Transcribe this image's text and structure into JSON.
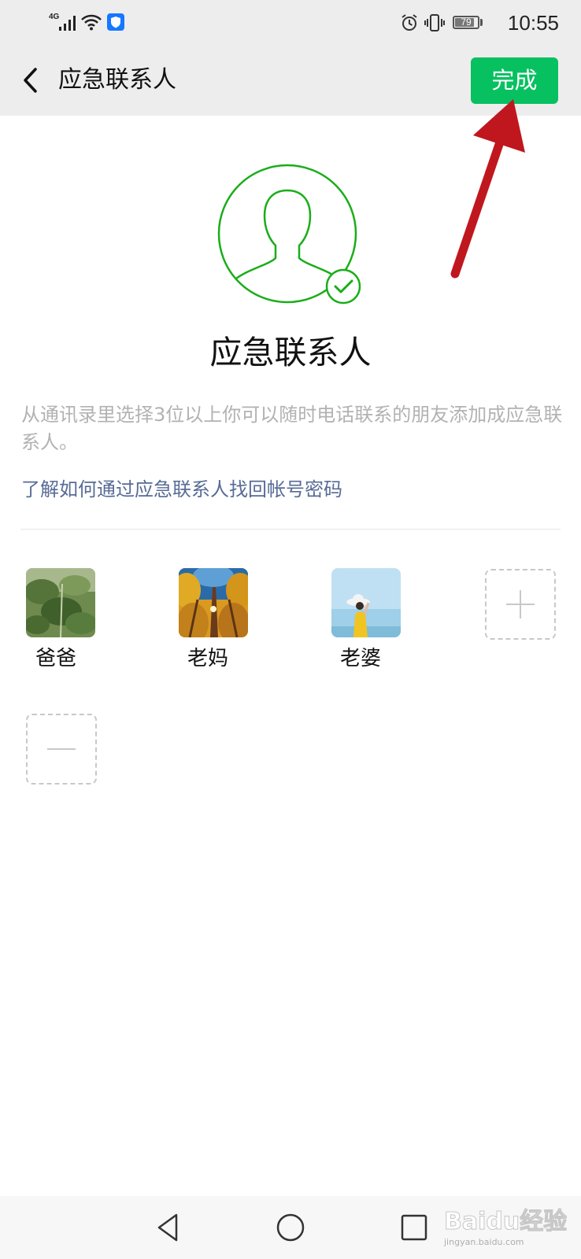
{
  "status_bar": {
    "network": "4G",
    "battery": "79",
    "battery_level": 0.79,
    "time": "10:55"
  },
  "header": {
    "title": "应急联系人",
    "done_label": "完成"
  },
  "hero": {
    "title": "应急联系人",
    "description": "从通讯录里选择3位以上你可以随时电话联系的朋友添加成应急联系人。",
    "help_link": "了解如何通过应急联系人找回帐号密码"
  },
  "contacts": [
    {
      "name": "爸爸",
      "photo": "green-plant-photo"
    },
    {
      "name": "老妈",
      "photo": "autumn-trees-photo"
    },
    {
      "name": "老婆",
      "photo": "woman-sky-photo"
    }
  ],
  "actions": {
    "add_icon": "plus-icon",
    "remove_icon": "minus-icon"
  },
  "watermark": "Baidu经验 jingyan.baidu.com",
  "colors": {
    "accent": "#07c160",
    "link": "#576b95",
    "muted_text": "#b2b2b2",
    "annotation": "#c0171e"
  }
}
